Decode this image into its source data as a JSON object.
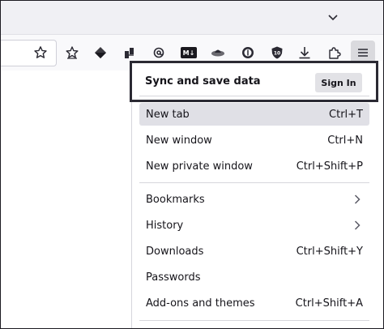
{
  "toolbar": {
    "icons": [
      "bookmark-star-icon",
      "extension-star-icon",
      "wallet-diamond-icon",
      "grab-extension-icon",
      "at-sign-icon",
      "markdown-icon",
      "spaceship-icon",
      "dollar-circle-icon",
      "shield-icon",
      "download-icon",
      "puzzle-icon",
      "hamburger-menu-icon"
    ],
    "badge_markdown": "M↓",
    "badge_shield": "10"
  },
  "app_menu": {
    "sync_title": "Sync and save data",
    "sign_in_label": "Sign In",
    "items": [
      {
        "label": "New tab",
        "shortcut": "Ctrl+T"
      },
      {
        "label": "New window",
        "shortcut": "Ctrl+N"
      },
      {
        "label": "New private window",
        "shortcut": "Ctrl+Shift+P"
      },
      {
        "label": "Bookmarks",
        "shortcut": ""
      },
      {
        "label": "History",
        "shortcut": ""
      },
      {
        "label": "Downloads",
        "shortcut": "Ctrl+Shift+Y"
      },
      {
        "label": "Passwords",
        "shortcut": ""
      },
      {
        "label": "Add-ons and themes",
        "shortcut": "Ctrl+Shift+A"
      }
    ]
  },
  "colors": {
    "toolbar_bg": "#f9f9fb",
    "tabstrip_bg": "#f0f0f4",
    "highlight_border": "#2b2a33",
    "hover_bg": "#e0e0e6"
  }
}
